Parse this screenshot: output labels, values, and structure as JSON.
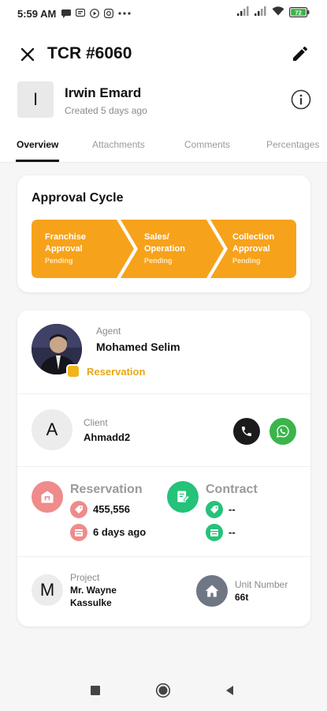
{
  "status_bar": {
    "time": "5:59 AM",
    "icons": [
      "message-icon",
      "chat-icon",
      "play-icon",
      "instagram-icon",
      "more-icon"
    ],
    "right_icons": [
      "signal-icon",
      "signal-icon",
      "wifi-icon",
      "battery-icon"
    ],
    "battery_level": "72"
  },
  "header": {
    "title": "TCR #6060",
    "avatar_letter": "I",
    "user_name": "Irwin Emard",
    "created": "Created 5 days ago"
  },
  "tabs": [
    {
      "label": "Overview",
      "active": true
    },
    {
      "label": "Attachments",
      "active": false
    },
    {
      "label": "Comments",
      "active": false
    },
    {
      "label": "Percentages",
      "active": false
    }
  ],
  "approval": {
    "title": "Approval Cycle",
    "color": "#f7a21b",
    "steps": [
      {
        "line1": "Franchise",
        "line2": "Approval",
        "status": "Pending"
      },
      {
        "line1": "Sales/",
        "line2": "Operation",
        "status": "Pending"
      },
      {
        "line1": "Collection",
        "line2": "Approval",
        "status": "Pending"
      }
    ]
  },
  "agent": {
    "label": "Agent",
    "name": "Mohamed Selim",
    "status": "Reservation"
  },
  "client": {
    "avatar_letter": "A",
    "label": "Client",
    "name": "Ahmadd2"
  },
  "reservation": {
    "title": "Reservation",
    "amount": "455,556",
    "date": "6 days ago"
  },
  "contract": {
    "title": "Contract",
    "amount": "--",
    "date": "--"
  },
  "project": {
    "avatar_letter": "M",
    "label": "Project",
    "name": "Mr. Wayne Kassulke"
  },
  "unit": {
    "label": "Unit Number",
    "value": "66t"
  }
}
